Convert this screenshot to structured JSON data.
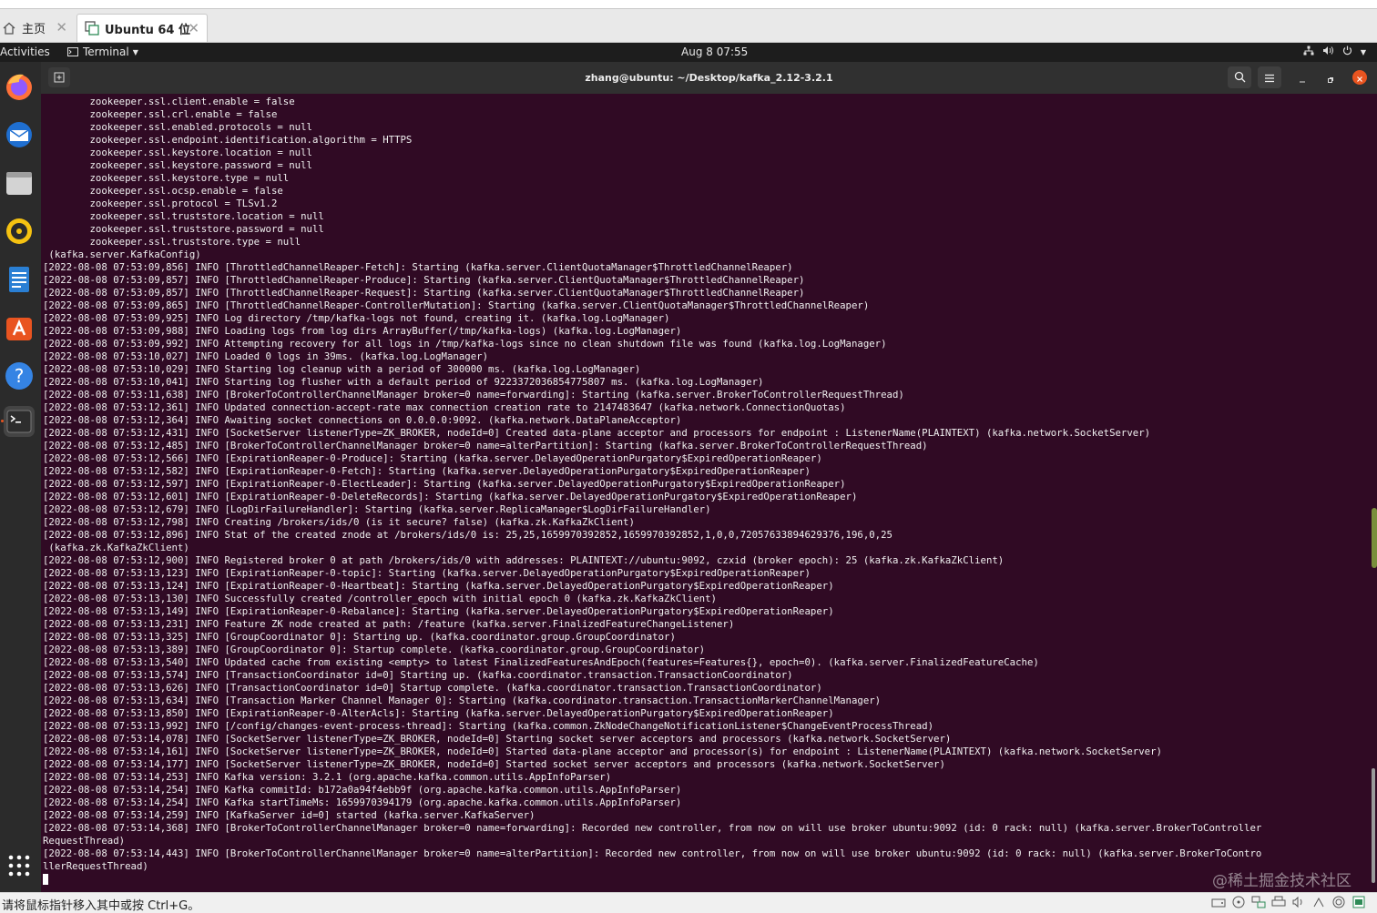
{
  "vmware": {
    "tabs": [
      {
        "label": "主页",
        "icon": "home-icon"
      },
      {
        "label": "Ubuntu 64 位",
        "icon": "vm-icon"
      }
    ],
    "status_hint": "请将鼠标指针移入其中或按 Ctrl+G。"
  },
  "gnome": {
    "activities": "Activities",
    "app_menu": "Terminal",
    "clock": "Aug 8  07:55",
    "tray_icons": [
      "network-icon",
      "volume-icon",
      "power-icon",
      "chevron-down-icon"
    ]
  },
  "dock": [
    "firefox-icon",
    "thunderbird-icon",
    "files-icon",
    "rhythmbox-icon",
    "writer-icon",
    "app-center-icon",
    "help-icon",
    "terminal-icon",
    "show-apps-icon"
  ],
  "terminal": {
    "title": "zhang@ubuntu: ~/Desktop/kafka_2.12-3.2.1",
    "lines": [
      "        zookeeper.ssl.client.enable = false",
      "        zookeeper.ssl.crl.enable = false",
      "        zookeeper.ssl.enabled.protocols = null",
      "        zookeeper.ssl.endpoint.identification.algorithm = HTTPS",
      "        zookeeper.ssl.keystore.location = null",
      "        zookeeper.ssl.keystore.password = null",
      "        zookeeper.ssl.keystore.type = null",
      "        zookeeper.ssl.ocsp.enable = false",
      "        zookeeper.ssl.protocol = TLSv1.2",
      "        zookeeper.ssl.truststore.location = null",
      "        zookeeper.ssl.truststore.password = null",
      "        zookeeper.ssl.truststore.type = null",
      " (kafka.server.KafkaConfig)",
      "[2022-08-08 07:53:09,856] INFO [ThrottledChannelReaper-Fetch]: Starting (kafka.server.ClientQuotaManager$ThrottledChannelReaper)",
      "[2022-08-08 07:53:09,857] INFO [ThrottledChannelReaper-Produce]: Starting (kafka.server.ClientQuotaManager$ThrottledChannelReaper)",
      "[2022-08-08 07:53:09,857] INFO [ThrottledChannelReaper-Request]: Starting (kafka.server.ClientQuotaManager$ThrottledChannelReaper)",
      "[2022-08-08 07:53:09,865] INFO [ThrottledChannelReaper-ControllerMutation]: Starting (kafka.server.ClientQuotaManager$ThrottledChannelReaper)",
      "[2022-08-08 07:53:09,925] INFO Log directory /tmp/kafka-logs not found, creating it. (kafka.log.LogManager)",
      "[2022-08-08 07:53:09,988] INFO Loading logs from log dirs ArrayBuffer(/tmp/kafka-logs) (kafka.log.LogManager)",
      "[2022-08-08 07:53:09,992] INFO Attempting recovery for all logs in /tmp/kafka-logs since no clean shutdown file was found (kafka.log.LogManager)",
      "[2022-08-08 07:53:10,027] INFO Loaded 0 logs in 39ms. (kafka.log.LogManager)",
      "[2022-08-08 07:53:10,029] INFO Starting log cleanup with a period of 300000 ms. (kafka.log.LogManager)",
      "[2022-08-08 07:53:10,041] INFO Starting log flusher with a default period of 9223372036854775807 ms. (kafka.log.LogManager)",
      "[2022-08-08 07:53:11,638] INFO [BrokerToControllerChannelManager broker=0 name=forwarding]: Starting (kafka.server.BrokerToControllerRequestThread)",
      "[2022-08-08 07:53:12,361] INFO Updated connection-accept-rate max connection creation rate to 2147483647 (kafka.network.ConnectionQuotas)",
      "[2022-08-08 07:53:12,364] INFO Awaiting socket connections on 0.0.0.0:9092. (kafka.network.DataPlaneAcceptor)",
      "[2022-08-08 07:53:12,431] INFO [SocketServer listenerType=ZK_BROKER, nodeId=0] Created data-plane acceptor and processors for endpoint : ListenerName(PLAINTEXT) (kafka.network.SocketServer)",
      "[2022-08-08 07:53:12,485] INFO [BrokerToControllerChannelManager broker=0 name=alterPartition]: Starting (kafka.server.BrokerToControllerRequestThread)",
      "[2022-08-08 07:53:12,566] INFO [ExpirationReaper-0-Produce]: Starting (kafka.server.DelayedOperationPurgatory$ExpiredOperationReaper)",
      "[2022-08-08 07:53:12,582] INFO [ExpirationReaper-0-Fetch]: Starting (kafka.server.DelayedOperationPurgatory$ExpiredOperationReaper)",
      "[2022-08-08 07:53:12,597] INFO [ExpirationReaper-0-ElectLeader]: Starting (kafka.server.DelayedOperationPurgatory$ExpiredOperationReaper)",
      "[2022-08-08 07:53:12,601] INFO [ExpirationReaper-0-DeleteRecords]: Starting (kafka.server.DelayedOperationPurgatory$ExpiredOperationReaper)",
      "[2022-08-08 07:53:12,679] INFO [LogDirFailureHandler]: Starting (kafka.server.ReplicaManager$LogDirFailureHandler)",
      "[2022-08-08 07:53:12,798] INFO Creating /brokers/ids/0 (is it secure? false) (kafka.zk.KafkaZkClient)",
      "[2022-08-08 07:53:12,896] INFO Stat of the created znode at /brokers/ids/0 is: 25,25,1659970392852,1659970392852,1,0,0,72057633894629376,196,0,25",
      " (kafka.zk.KafkaZkClient)",
      "[2022-08-08 07:53:12,900] INFO Registered broker 0 at path /brokers/ids/0 with addresses: PLAINTEXT://ubuntu:9092, czxid (broker epoch): 25 (kafka.zk.KafkaZkClient)",
      "[2022-08-08 07:53:13,123] INFO [ExpirationReaper-0-topic]: Starting (kafka.server.DelayedOperationPurgatory$ExpiredOperationReaper)",
      "[2022-08-08 07:53:13,124] INFO [ExpirationReaper-0-Heartbeat]: Starting (kafka.server.DelayedOperationPurgatory$ExpiredOperationReaper)",
      "[2022-08-08 07:53:13,130] INFO Successfully created /controller_epoch with initial epoch 0 (kafka.zk.KafkaZkClient)",
      "[2022-08-08 07:53:13,149] INFO [ExpirationReaper-0-Rebalance]: Starting (kafka.server.DelayedOperationPurgatory$ExpiredOperationReaper)",
      "[2022-08-08 07:53:13,231] INFO Feature ZK node created at path: /feature (kafka.server.FinalizedFeatureChangeListener)",
      "[2022-08-08 07:53:13,325] INFO [GroupCoordinator 0]: Starting up. (kafka.coordinator.group.GroupCoordinator)",
      "[2022-08-08 07:53:13,389] INFO [GroupCoordinator 0]: Startup complete. (kafka.coordinator.group.GroupCoordinator)",
      "[2022-08-08 07:53:13,540] INFO Updated cache from existing <empty> to latest FinalizedFeaturesAndEpoch(features=Features{}, epoch=0). (kafka.server.FinalizedFeatureCache)",
      "[2022-08-08 07:53:13,574] INFO [TransactionCoordinator id=0] Starting up. (kafka.coordinator.transaction.TransactionCoordinator)",
      "[2022-08-08 07:53:13,626] INFO [TransactionCoordinator id=0] Startup complete. (kafka.coordinator.transaction.TransactionCoordinator)",
      "[2022-08-08 07:53:13,634] INFO [Transaction Marker Channel Manager 0]: Starting (kafka.coordinator.transaction.TransactionMarkerChannelManager)",
      "[2022-08-08 07:53:13,850] INFO [ExpirationReaper-0-AlterAcls]: Starting (kafka.server.DelayedOperationPurgatory$ExpiredOperationReaper)",
      "[2022-08-08 07:53:13,992] INFO [/config/changes-event-process-thread]: Starting (kafka.common.ZkNodeChangeNotificationListener$ChangeEventProcessThread)",
      "[2022-08-08 07:53:14,078] INFO [SocketServer listenerType=ZK_BROKER, nodeId=0] Starting socket server acceptors and processors (kafka.network.SocketServer)",
      "[2022-08-08 07:53:14,161] INFO [SocketServer listenerType=ZK_BROKER, nodeId=0] Started data-plane acceptor and processor(s) for endpoint : ListenerName(PLAINTEXT) (kafka.network.SocketServer)",
      "[2022-08-08 07:53:14,177] INFO [SocketServer listenerType=ZK_BROKER, nodeId=0] Started socket server acceptors and processors (kafka.network.SocketServer)",
      "[2022-08-08 07:53:14,253] INFO Kafka version: 3.2.1 (org.apache.kafka.common.utils.AppInfoParser)",
      "[2022-08-08 07:53:14,254] INFO Kafka commitId: b172a0a94f4ebb9f (org.apache.kafka.common.utils.AppInfoParser)",
      "[2022-08-08 07:53:14,254] INFO Kafka startTimeMs: 1659970394179 (org.apache.kafka.common.utils.AppInfoParser)",
      "[2022-08-08 07:53:14,259] INFO [KafkaServer id=0] started (kafka.server.KafkaServer)",
      "[2022-08-08 07:53:14,368] INFO [BrokerToControllerChannelManager broker=0 name=forwarding]: Recorded new controller, from now on will use broker ubuntu:9092 (id: 0 rack: null) (kafka.server.BrokerToController",
      "RequestThread)",
      "[2022-08-08 07:53:14,443] INFO [BrokerToControllerChannelManager broker=0 name=alterPartition]: Recorded new controller, from now on will use broker ubuntu:9092 (id: 0 rack: null) (kafka.server.BrokerToContro",
      "llerRequestThread)"
    ]
  },
  "watermark": "@稀土掘金技术社区",
  "colors": {
    "terminal_bg": "#300a24",
    "header_bg": "#303030",
    "dock_bg": "#2b2b2b",
    "close_button": "#e95420"
  }
}
